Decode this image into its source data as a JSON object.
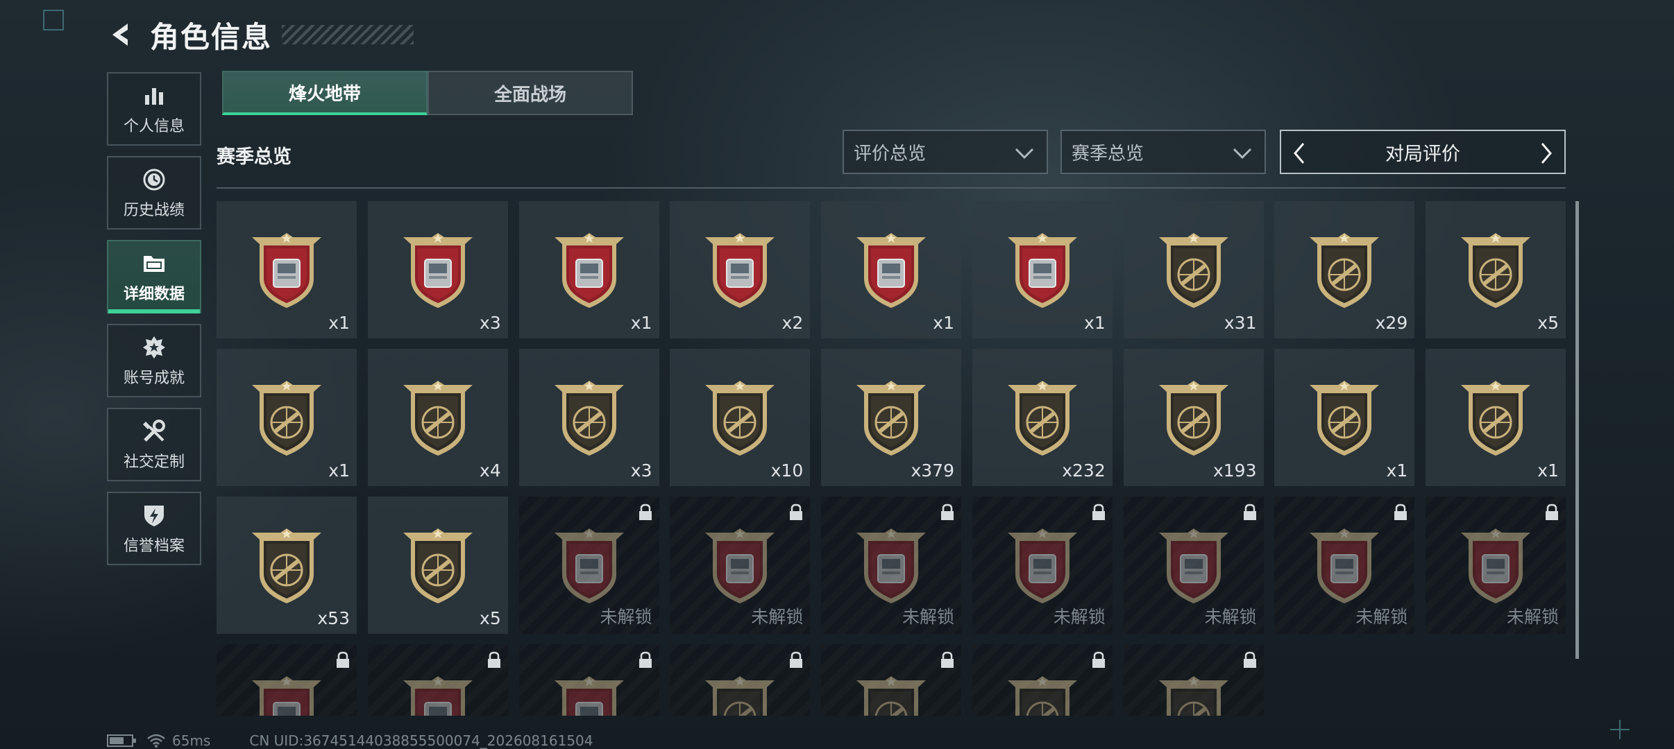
{
  "header": {
    "title": "角色信息",
    "back_icon": "back-arrow-icon"
  },
  "sidebar": {
    "items": [
      {
        "label": "个人信息",
        "icon": "bar-chart-icon",
        "active": false
      },
      {
        "label": "历史战绩",
        "icon": "history-clock-icon",
        "active": false
      },
      {
        "label": "详细数据",
        "icon": "folder-icon",
        "active": true
      },
      {
        "label": "账号成就",
        "icon": "medal-icon",
        "active": false
      },
      {
        "label": "社交定制",
        "icon": "tools-icon",
        "active": false
      },
      {
        "label": "信誉档案",
        "icon": "shield-lightning-icon",
        "active": false
      }
    ]
  },
  "tabs": [
    {
      "label": "烽火地带",
      "active": true
    },
    {
      "label": "全面战场",
      "active": false
    }
  ],
  "section": {
    "title": "赛季总览"
  },
  "filters": {
    "rating_dropdown": "评价总览",
    "season_dropdown": "赛季总览",
    "pager_label": "对局评价"
  },
  "colors": {
    "accent": "#3fd29a",
    "badge_red": "#8e1f27",
    "badge_gold": "#c9b27c"
  },
  "medals": [
    {
      "count": "x1",
      "icon": "diamond-item-icon",
      "type": "item",
      "locked": false
    },
    {
      "count": "x3",
      "icon": "tank-model-icon",
      "type": "item",
      "locked": false
    },
    {
      "count": "x1",
      "icon": "server-card-icon",
      "type": "item",
      "locked": false
    },
    {
      "count": "x2",
      "icon": "metal-plate-icon",
      "type": "item",
      "locked": false
    },
    {
      "count": "x1",
      "icon": "circuit-board-icon",
      "type": "item",
      "locked": false
    },
    {
      "count": "x1",
      "icon": "machine-device-icon",
      "type": "item",
      "locked": false
    },
    {
      "count": "x31",
      "icon": "assault-rifle-medal-icon",
      "type": "gold",
      "locked": false
    },
    {
      "count": "x29",
      "icon": "smg-medal-icon",
      "type": "gold",
      "locked": false
    },
    {
      "count": "x5",
      "icon": "shotgun-medal-icon",
      "type": "gold",
      "locked": false
    },
    {
      "count": "x1",
      "icon": "lmg-medal-icon",
      "type": "gold",
      "locked": false
    },
    {
      "count": "x4",
      "icon": "marksman-rifle-medal-icon",
      "type": "gold",
      "locked": false
    },
    {
      "count": "x3",
      "icon": "sniper-rifle-medal-icon",
      "type": "gold",
      "locked": false
    },
    {
      "count": "x10",
      "icon": "pistol-medal-icon",
      "type": "gold",
      "locked": false
    },
    {
      "count": "x379",
      "icon": "knife-medal-icon",
      "type": "gold",
      "locked": false
    },
    {
      "count": "x232",
      "icon": "explosion-skull-medal-icon",
      "type": "gold",
      "locked": false
    },
    {
      "count": "x193",
      "icon": "wreath-emblem-medal-icon",
      "type": "gold",
      "locked": false
    },
    {
      "count": "x1",
      "icon": "chevron-wreath-medal-icon",
      "type": "gold",
      "locked": false
    },
    {
      "count": "x1",
      "icon": "beret-soldier-medal-icon",
      "type": "gold",
      "locked": false
    },
    {
      "count": "x53",
      "icon": "female-operator-medal-icon",
      "type": "gold",
      "locked": false
    },
    {
      "count": "x5",
      "icon": "male-operator-medal-icon",
      "type": "gold",
      "locked": false
    },
    {
      "count": "未解锁",
      "icon": "crystal-orb-icon",
      "type": "item",
      "locked": true
    },
    {
      "count": "未解锁",
      "icon": "terminal-device-icon",
      "type": "item",
      "locked": true
    },
    {
      "count": "未解锁",
      "icon": "server-rack-icon",
      "type": "item",
      "locked": true
    },
    {
      "count": "未解锁",
      "icon": "robot-arm-icon",
      "type": "item",
      "locked": true
    },
    {
      "count": "未解锁",
      "icon": "lantern-cage-icon",
      "type": "item",
      "locked": true
    },
    {
      "count": "未解锁",
      "icon": "jewel-box-icon",
      "type": "item",
      "locked": true
    },
    {
      "count": "未解锁",
      "icon": "chess-case-icon",
      "type": "item",
      "locked": true
    },
    {
      "count": "",
      "icon": "painting-frame-icon",
      "type": "item",
      "locked": true
    },
    {
      "count": "",
      "icon": "mech-part-icon",
      "type": "item",
      "locked": true
    },
    {
      "count": "",
      "icon": "gear-cluster-icon",
      "type": "item",
      "locked": true
    },
    {
      "count": "",
      "icon": "skull-medal-icon",
      "type": "gold",
      "locked": true
    },
    {
      "count": "",
      "icon": "skull-medal-icon",
      "type": "gold",
      "locked": true
    },
    {
      "count": "",
      "icon": "skull-medal-icon",
      "type": "gold",
      "locked": true
    },
    {
      "count": "",
      "icon": "skull-medal-icon",
      "type": "gold",
      "locked": true
    }
  ],
  "status": {
    "ping": "65ms",
    "uid": "CN UID:36745144038855500074_202608161504"
  }
}
